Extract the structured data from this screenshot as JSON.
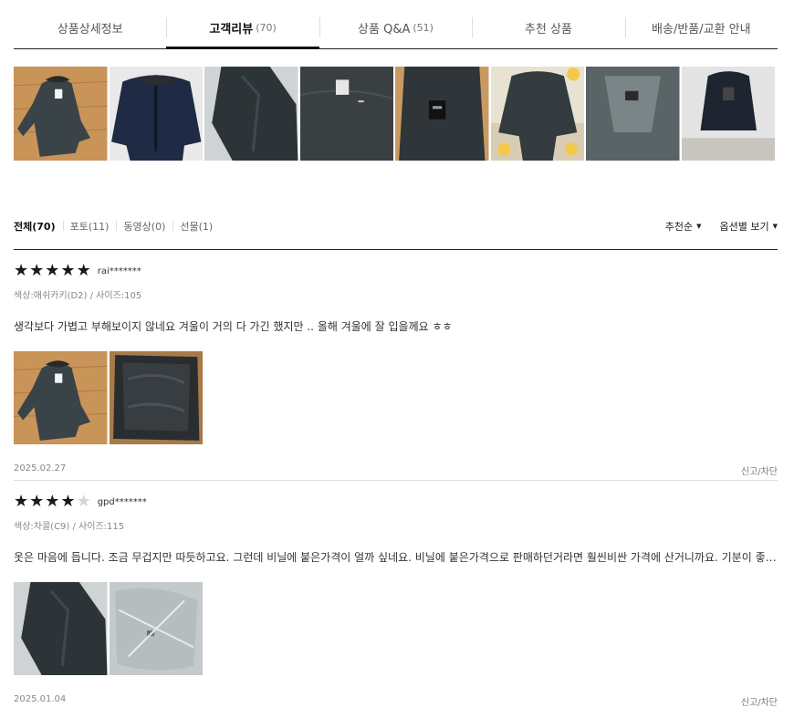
{
  "tabs": [
    {
      "label": "상품상세정보",
      "count": ""
    },
    {
      "label": "고객리뷰",
      "count": "(70)"
    },
    {
      "label": "상품 Q&A",
      "count": "(51)"
    },
    {
      "label": "추천 상품",
      "count": ""
    },
    {
      "label": "배송/반품/교환 안내",
      "count": ""
    }
  ],
  "filters": [
    "전체(70)",
    "포토(11)",
    "동영상(0)",
    "선물(1)"
  ],
  "sorts": [
    "추천순",
    "옵션별 보기"
  ],
  "reviews": [
    {
      "rating": 5,
      "reviewer": "rai*******",
      "option": "색상:애쉬카키(D2) / 사이즈:105",
      "body": "생각보다 가볍고 부해보이지 않네요 겨울이 거의 다 가긴 했지만 .. 올해 겨울에 잘 입을께요 ㅎㅎ",
      "date": "2025.02.27",
      "report": "신고/차단"
    },
    {
      "rating": 4,
      "reviewer": "gpd*******",
      "option": "색상:차콜(C9) / 사이즈:115",
      "body": "옷은 마음에 듭니다. 조금 무겁지만 따듯하고요. 그런데 비닐에 붙은가격이 얼까 싶네요. 비닐에 붙은가격으로 판매하던거라면 훨씬비싼 가격에 산거니까요. 기분이 좋지는않네...",
      "date": "2025.01.04",
      "report": "신고/차단"
    }
  ],
  "icons": {
    "star": "star-icon",
    "caret": "caret-down-icon"
  },
  "colors": {
    "active_tab": "#111111",
    "star_on": "#1a1a1a",
    "star_off": "#d4d4d4",
    "wood_floor": "#c89458",
    "coat_dark": "#3a4348"
  }
}
